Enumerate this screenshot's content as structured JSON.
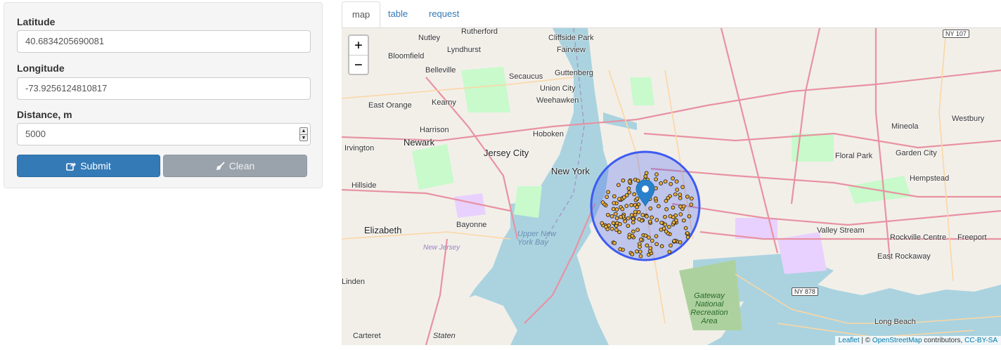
{
  "form": {
    "latitude": {
      "label": "Latitude",
      "value": "40.6834205690081"
    },
    "longitude": {
      "label": "Longitude",
      "value": "-73.9256124810817"
    },
    "distance": {
      "label": "Distance, m",
      "value": "5000"
    },
    "submit_label": "Submit",
    "clean_label": "Clean"
  },
  "tabs": [
    {
      "label": "map",
      "active": true
    },
    {
      "label": "table",
      "active": false
    },
    {
      "label": "request",
      "active": false
    }
  ],
  "map": {
    "zoom_in": "+",
    "zoom_out": "−",
    "attribution": {
      "leaflet": "Leaflet",
      "sep": " | © ",
      "osm": "OpenStreetMap",
      "contrib": " contributors, ",
      "license": "CC-BY-SA"
    },
    "places": {
      "new_york": "New York",
      "newark": "Newark",
      "jersey_city": "Jersey City",
      "hoboken": "Hoboken",
      "elizabeth": "Elizabeth",
      "bayonne": "Bayonne",
      "nutley": "Nutley",
      "rutherford": "Rutherford",
      "cliffside_park": "Cliffside Park",
      "fairview": "Fairview",
      "bloomfield": "Bloomfield",
      "lyndhurst": "Lyndhurst",
      "belleville": "Belleville",
      "secaucus": "Secaucus",
      "guttenberg": "Guttenberg",
      "union_city": "Union City",
      "weehawken": "Weehawken",
      "east_orange": "East Orange",
      "kearny": "Kearny",
      "harrison": "Harrison",
      "irvington": "Irvington",
      "hillside": "Hillside",
      "floral_park": "Floral Park",
      "garden_city": "Garden City",
      "mineola": "Mineola",
      "westbury": "Westbury",
      "hempstead": "Hempstead",
      "valley_stream": "Valley Stream",
      "rockville_centre": "Rockville Centre",
      "freeport": "Freeport",
      "east_rockaway": "East Rockaway",
      "long_beach": "Long Beach",
      "linden": "Linden",
      "carteret": "Carteret",
      "staten": "Staten",
      "upper_new_york_bay": "Upper New York Bay",
      "new_jersey": "New Jersey",
      "gateway": "Gateway National Recreation Area"
    },
    "highways": {
      "ny107": "NY 107",
      "ny878": "NY 878"
    },
    "colors": {
      "circle": "#3d5af1",
      "points": "#f0b23a",
      "marker": "#2a81cb"
    }
  }
}
